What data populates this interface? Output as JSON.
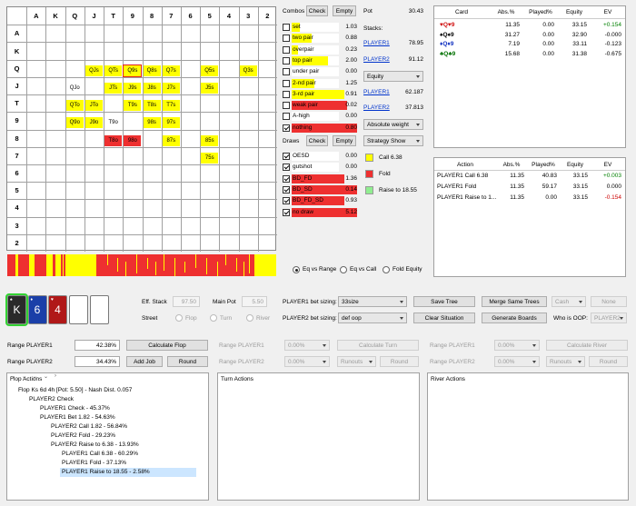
{
  "grid": {
    "ranks": [
      "A",
      "K",
      "Q",
      "J",
      "T",
      "9",
      "8",
      "7",
      "6",
      "5",
      "4",
      "3",
      "2"
    ],
    "hands": [
      {
        "r": 2,
        "c": 3,
        "t": "QJs",
        "k": "y"
      },
      {
        "r": 2,
        "c": 4,
        "t": "QTs",
        "k": "y"
      },
      {
        "r": 2,
        "c": 5,
        "t": "Q9s",
        "k": "y",
        "sel": true
      },
      {
        "r": 2,
        "c": 6,
        "t": "Q8s",
        "k": "y"
      },
      {
        "r": 2,
        "c": 7,
        "t": "Q7s",
        "k": "y"
      },
      {
        "r": 2,
        "c": 9,
        "t": "Q5s",
        "k": "y"
      },
      {
        "r": 2,
        "c": 11,
        "t": "Q3s",
        "k": "y"
      },
      {
        "r": 3,
        "c": 2,
        "t": "QJo",
        "k": ""
      },
      {
        "r": 3,
        "c": 4,
        "t": "JTs",
        "k": "y"
      },
      {
        "r": 3,
        "c": 5,
        "t": "J9s",
        "k": "y"
      },
      {
        "r": 3,
        "c": 6,
        "t": "J8s",
        "k": "y"
      },
      {
        "r": 3,
        "c": 7,
        "t": "J7s",
        "k": "y"
      },
      {
        "r": 3,
        "c": 9,
        "t": "J5s",
        "k": "y"
      },
      {
        "r": 4,
        "c": 2,
        "t": "QTo",
        "k": "y"
      },
      {
        "r": 4,
        "c": 3,
        "t": "JTo",
        "k": "y"
      },
      {
        "r": 4,
        "c": 5,
        "t": "T9s",
        "k": "y"
      },
      {
        "r": 4,
        "c": 6,
        "t": "T8s",
        "k": "y"
      },
      {
        "r": 4,
        "c": 7,
        "t": "T7s",
        "k": "y"
      },
      {
        "r": 5,
        "c": 2,
        "t": "Q9o",
        "k": "y"
      },
      {
        "r": 5,
        "c": 3,
        "t": "J9o",
        "k": "y"
      },
      {
        "r": 5,
        "c": 4,
        "t": "T9o",
        "k": ""
      },
      {
        "r": 5,
        "c": 6,
        "t": "98s",
        "k": "y"
      },
      {
        "r": 5,
        "c": 7,
        "t": "97s",
        "k": "y"
      },
      {
        "r": 6,
        "c": 4,
        "t": "T8o",
        "k": "r"
      },
      {
        "r": 6,
        "c": 5,
        "t": "98o",
        "k": "r"
      },
      {
        "r": 6,
        "c": 7,
        "t": "87s",
        "k": "y"
      },
      {
        "r": 6,
        "c": 9,
        "t": "85s",
        "k": "y"
      },
      {
        "r": 7,
        "c": 9,
        "t": "75s",
        "k": "y"
      }
    ]
  },
  "combos": {
    "title": "Combos",
    "check": "Check",
    "empty": "Empty",
    "rows": [
      {
        "name": "set",
        "val": "1.03",
        "p": 0.12,
        "k": "y"
      },
      {
        "name": "two pair",
        "val": "0.88",
        "p": 0.3,
        "k": "y"
      },
      {
        "name": "overpair",
        "val": "0.23",
        "p": 0.1,
        "k": "y"
      },
      {
        "name": "top pair",
        "val": "2.00",
        "p": 0.55,
        "k": "y"
      },
      {
        "name": "under pair",
        "val": "0.00",
        "p": 0.0,
        "k": "y"
      },
      {
        "name": "2-nd pair",
        "val": "1.25",
        "p": 0.35,
        "k": "y"
      },
      {
        "name": "3-rd pair",
        "val": "0.91",
        "p": 0.8,
        "k": "y"
      },
      {
        "name": "weak pair",
        "val": "0.02",
        "p": 0.85,
        "k": "r"
      },
      {
        "name": "A-high",
        "val": "0.00",
        "p": 0.0,
        "k": "y"
      },
      {
        "name": "nothing",
        "val": "0.80",
        "p": 1.0,
        "k": "r",
        "checked": true
      }
    ]
  },
  "draws": {
    "title": "Draws",
    "check": "Check",
    "empty": "Empty",
    "rows": [
      {
        "name": "OESD",
        "val": "0.00",
        "p": 0.0,
        "k": "y",
        "checked": true
      },
      {
        "name": "gutshot",
        "val": "0.00",
        "p": 0.0,
        "k": "y",
        "checked": true
      },
      {
        "name": "BD_FD",
        "val": "1.36",
        "p": 0.8,
        "k": "r",
        "checked": true
      },
      {
        "name": "BD_SD",
        "val": "0.14",
        "p": 1.0,
        "k": "r",
        "checked": true
      },
      {
        "name": "BD_FD_SD",
        "val": "0.93",
        "p": 0.8,
        "k": "r",
        "checked": true
      },
      {
        "name": "no draw",
        "val": "5.12",
        "p": 1.0,
        "k": "r",
        "checked": true
      }
    ]
  },
  "stats": {
    "pot_label": "Pot",
    "pot": "30.43",
    "stacks_label": "Stacks:",
    "p1": "PLAYER1",
    "p1_stack": "78.95",
    "p2": "PLAYER2",
    "p2_stack": "91.12",
    "equity_select": "Equity",
    "p1_eq": "62.187",
    "p2_eq": "37.813",
    "weight_select": "Absolute weight",
    "strategy_select": "Strategy Show",
    "legend": [
      {
        "label": "Call 6.38",
        "color": "#ffff00"
      },
      {
        "label": "Fold",
        "color": "#ee3030"
      },
      {
        "label": "Raise to 18.55",
        "color": "#90ee90"
      }
    ]
  },
  "card_table": {
    "headers": [
      "Card",
      "Abs.%",
      "Played%",
      "Equity",
      "EV"
    ],
    "rows": [
      {
        "card": "♥Q♥9",
        "abs": "11.35",
        "played": "0.00",
        "equity": "33.15",
        "ev": "+0.154",
        "sc": "#d01010",
        "evc": "#008000"
      },
      {
        "card": "♠Q♠9",
        "abs": "31.27",
        "played": "0.00",
        "equity": "32.90",
        "ev": "-0.000",
        "sc": "#000000",
        "evc": "#000000"
      },
      {
        "card": "♦Q♦9",
        "abs": "7.19",
        "played": "0.00",
        "equity": "33.11",
        "ev": "-0.123",
        "sc": "#1030c0",
        "evc": "#000000"
      },
      {
        "card": "♣Q♣9",
        "abs": "15.68",
        "played": "0.00",
        "equity": "31.38",
        "ev": "-0.675",
        "sc": "#007000",
        "evc": "#000000"
      }
    ]
  },
  "action_table": {
    "headers": [
      "Action",
      "Abs.%",
      "Played%",
      "Equity",
      "EV"
    ],
    "rows": [
      {
        "action": "PLAYER1 Call 6.38",
        "abs": "11.35",
        "played": "40.83",
        "equity": "33.15",
        "ev": "+0.003",
        "evc": "#008000"
      },
      {
        "action": "PLAYER1 Fold",
        "abs": "11.35",
        "played": "59.17",
        "equity": "33.15",
        "ev": "0.000",
        "evc": "#000000"
      },
      {
        "action": "PLAYER1 Raise to 1...",
        "abs": "11.35",
        "played": "0.00",
        "equity": "33.15",
        "ev": "-0.154",
        "evc": "#cc0000"
      }
    ]
  },
  "radios": [
    {
      "label": "Eq vs Range",
      "on": true
    },
    {
      "label": "Eq vs Call",
      "on": false
    },
    {
      "label": "Fold Equity",
      "on": false
    }
  ],
  "board": [
    {
      "rank": "K",
      "suit": "♠",
      "color": "#2a2a2a",
      "sel": true
    },
    {
      "rank": "6",
      "suit": "♦",
      "color": "#1a3fa8"
    },
    {
      "rank": "4",
      "suit": "♥",
      "color": "#b01818"
    }
  ],
  "controls": {
    "eff_stack_label": "Eff. Stack",
    "eff_stack": "97.50",
    "main_pot_label": "Main Pot",
    "main_pot": "5.50",
    "street_label": "Street",
    "streets": [
      "Flop",
      "Turn",
      "River"
    ],
    "p1_bet_label": "PLAYER1 bet sizing:",
    "p1_bet": "33size",
    "p2_bet_label": "PLAYER2 bet sizing:",
    "p2_bet": "def oop",
    "save_tree": "Save Tree",
    "merge": "Merge Same Trees",
    "cash": "Cash",
    "none": "None",
    "clear": "Clear Situation",
    "gen": "Generate Boards",
    "oop_label": "Who is OOP:",
    "oop": "PLAYER2"
  },
  "ranges": {
    "p1_label": "Range PLAYER1",
    "p2_label": "Range PLAYER2",
    "p1_flop": "42.38%",
    "p2_flop": "34.43%",
    "calc_flop": "Calculate Flop",
    "add_job": "Add Job",
    "round": "Round",
    "zero": "0.00%",
    "calc_turn": "Calculate Turn",
    "calc_river": "Calculate River",
    "runouts": "Runouts"
  },
  "flop_actions": {
    "title": "Flop Actions",
    "items": [
      {
        "t": "Flop Ks 6d 4h [Pot: 5.50] - Nash Dist. 0.057",
        "d": 0,
        "e": "v"
      },
      {
        "t": "PLAYER2 Check",
        "d": 1,
        "e": "v"
      },
      {
        "t": "PLAYER1 Check - 45.37%",
        "d": 2,
        "e": ""
      },
      {
        "t": "PLAYER1 Bet 1.82 - 54.63%",
        "d": 2,
        "e": "v"
      },
      {
        "t": "PLAYER2 Call 1.82 - 56.84%",
        "d": 3,
        "e": ""
      },
      {
        "t": "PLAYER2 Fold - 29.23%",
        "d": 3,
        "e": ""
      },
      {
        "t": "PLAYER2 Raise to 6.38 - 13.93%",
        "d": 3,
        "e": "v"
      },
      {
        "t": "PLAYER1 Call 6.38 - 60.29%",
        "d": 4,
        "e": ""
      },
      {
        "t": "PLAYER1 Fold - 37.13%",
        "d": 4,
        "e": ""
      },
      {
        "t": "PLAYER1 Raise to 18.55 - 2.58%",
        "d": 4,
        "e": ">",
        "sel": true
      }
    ]
  },
  "turn_actions": {
    "title": "Turn Actions"
  },
  "river_actions": {
    "title": "River Actions"
  }
}
